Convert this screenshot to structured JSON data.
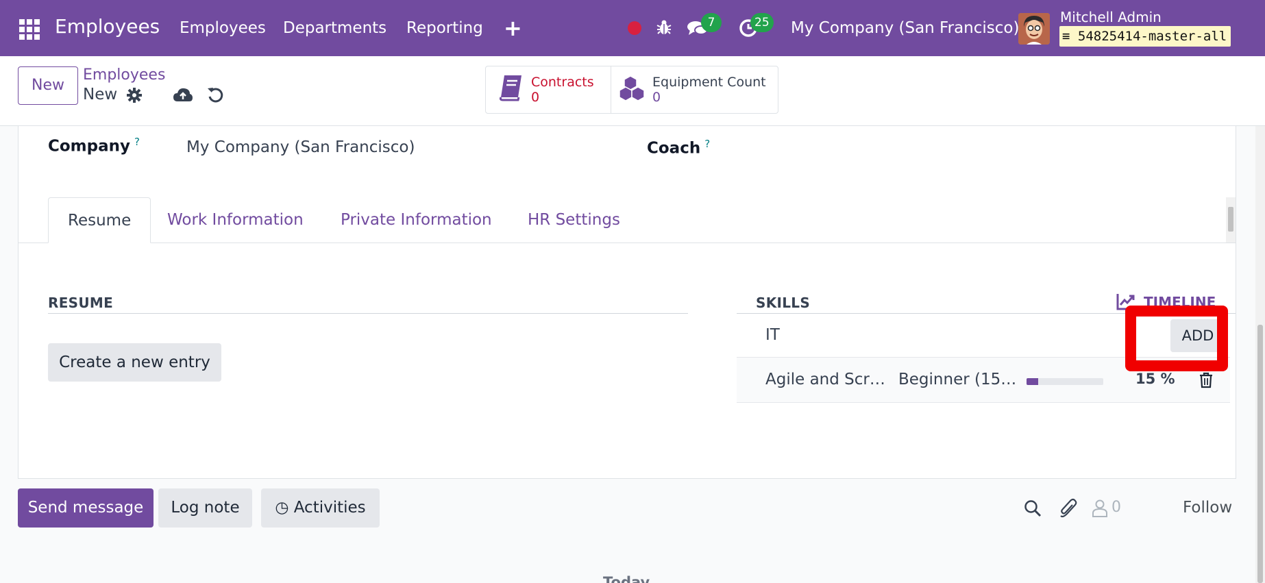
{
  "navbar": {
    "brand": "Employees",
    "menu": [
      "Employees",
      "Departments",
      "Reporting"
    ],
    "chat_badge": "7",
    "activity_badge": "25",
    "company": "My Company (San Francisco)",
    "user_name": "Mitchell Admin",
    "db_name": "54825414-master-all",
    "icons": [
      "apps-grid-icon",
      "plus-icon",
      "record-dot-icon",
      "bug-icon",
      "chat-icon",
      "activity-clock-icon",
      "database-icon"
    ],
    "colors": {
      "brand": "#714b9f",
      "badge": "#22a34c",
      "record": "#d9203f"
    }
  },
  "control": {
    "new_label": "New",
    "breadcrumb_parent": "Employees",
    "breadcrumb_current": "New",
    "smart_buttons": [
      {
        "label": "Contracts",
        "value": "0",
        "icon": "book-icon",
        "color": "#c8102e"
      },
      {
        "label": "Equipment Count",
        "value": "0",
        "icon": "cubes-icon"
      }
    ]
  },
  "form": {
    "company_label": "Company",
    "company_value": "My Company (San Francisco)",
    "coach_label": "Coach",
    "help_mark": "?",
    "tabs": [
      "Resume",
      "Work Information",
      "Private Information",
      "HR Settings"
    ],
    "active_tab": "Resume",
    "resume": {
      "title": "RESUME",
      "create_entry_label": "Create a new entry"
    },
    "skills": {
      "title": "SKILLS",
      "timeline_label": "TIMELINE",
      "group": "IT",
      "add_label": "ADD",
      "rows": [
        {
          "name": "Agile and Scr…",
          "level": "Beginner (15…",
          "progress": 15,
          "progress_label": "15 %"
        }
      ]
    }
  },
  "chatter": {
    "send_message": "Send message",
    "log_note": "Log note",
    "activities": "Activities",
    "followers_count": "0",
    "follow": "Follow",
    "today": "Today"
  },
  "annotation": {
    "highlight_color": "#f00000",
    "target": "ADD"
  }
}
